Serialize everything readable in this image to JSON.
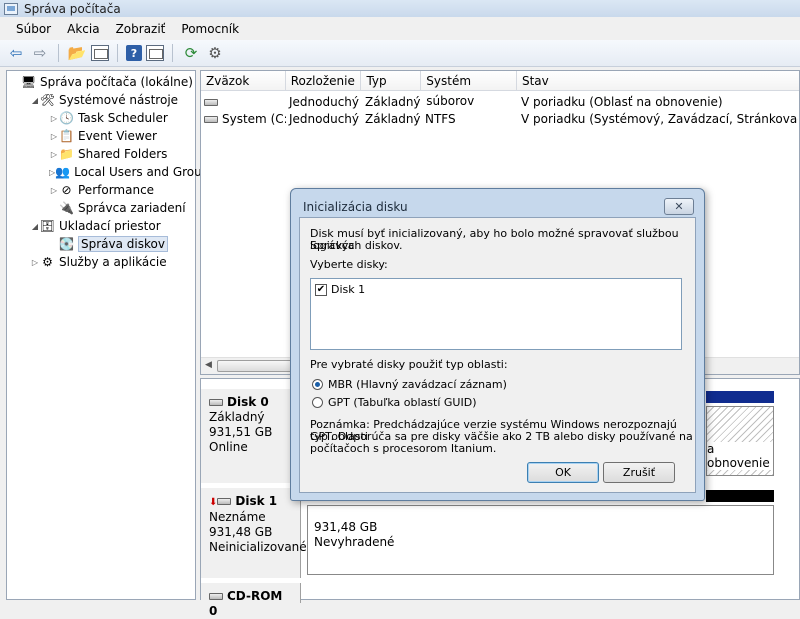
{
  "window": {
    "title": "Správa počítača"
  },
  "menu": [
    "Súbor",
    "Akcia",
    "Zobraziť",
    "Pomocník"
  ],
  "tree": [
    {
      "label": "Správa počítača (lokálne)",
      "level": 0,
      "expander": "",
      "icon": "computer-icon",
      "glyph": "🖥"
    },
    {
      "label": "Systémové nástroje",
      "level": 1,
      "expander": "◢",
      "icon": "tools-icon",
      "glyph": "🛠"
    },
    {
      "label": "Task Scheduler",
      "level": 2,
      "expander": "▷",
      "icon": "clock-icon",
      "glyph": "🕓"
    },
    {
      "label": "Event Viewer",
      "level": 2,
      "expander": "▷",
      "icon": "event-viewer-icon",
      "glyph": "📋"
    },
    {
      "label": "Shared Folders",
      "level": 2,
      "expander": "▷",
      "icon": "shared-folder-icon",
      "glyph": "📁"
    },
    {
      "label": "Local Users and Groups",
      "level": 2,
      "expander": "▷",
      "icon": "users-icon",
      "glyph": "👥"
    },
    {
      "label": "Performance",
      "level": 2,
      "expander": "▷",
      "icon": "performance-icon",
      "glyph": "⊘"
    },
    {
      "label": "Správca zariadení",
      "level": 2,
      "expander": "",
      "icon": "device-manager-icon",
      "glyph": "🔌"
    },
    {
      "label": "Ukladací priestor",
      "level": 1,
      "expander": "◢",
      "icon": "storage-icon",
      "glyph": "🗄"
    },
    {
      "label": "Správa diskov",
      "level": 2,
      "expander": "",
      "icon": "disk-management-icon",
      "glyph": "💽",
      "selected": true
    },
    {
      "label": "Služby a aplikácie",
      "level": 1,
      "expander": "▷",
      "icon": "services-icon",
      "glyph": "⚙"
    }
  ],
  "volumes": {
    "headers": [
      "Zväzok",
      "Rozloženie",
      "Typ",
      "Systém súborov",
      "Stav"
    ],
    "rows": [
      [
        "",
        "Jednoduchý",
        "Základný",
        "",
        "V poriadku (Oblasť na obnovenie)"
      ],
      [
        "System (C:)",
        "Jednoduchý",
        "Základný",
        "NTFS",
        "V poriadku (Systémový, Zavádzací, Stránkovací súbor"
      ]
    ]
  },
  "disks": {
    "disk0": {
      "name": "Disk 0",
      "type": "Základný",
      "size": "931,51 GB",
      "status": "Online",
      "partition_status": "a obnovenie"
    },
    "disk1": {
      "name": "Disk 1",
      "type": "Neznáme",
      "size": "931,48 GB",
      "status": "Neinicializované",
      "unalloc_size": "931,48 GB",
      "unalloc_label": "Nevyhradené"
    },
    "cdrom": {
      "name": "CD-ROM 0"
    }
  },
  "dialog": {
    "title": "Inicializácia disku",
    "intro_line1": "Disk musí byť inicializovaný, aby ho bolo možné spravovať službou Správca",
    "intro_line2": "logických diskov.",
    "select_label": "Vyberte disky:",
    "disk_item": "Disk 1",
    "disk_checked": true,
    "style_label": "Pre vybraté disky použiť typ oblasti:",
    "mbr_label": "MBR (Hlavný zavádzací záznam)",
    "gpt_label": "GPT (Tabuľka oblastí GUID)",
    "selected_style": "MBR",
    "note_line1": "Poznámka: Predchádzajúce verzie systému Windows nerozpoznajú typ oblasti",
    "note_line2": "GPT. Odporúča sa pre disky väčšie ako 2 TB alebo disky používané na",
    "note_line3": "počítačoch s procesorom Itanium.",
    "ok_label": "OK",
    "cancel_label": "Zrušiť"
  }
}
